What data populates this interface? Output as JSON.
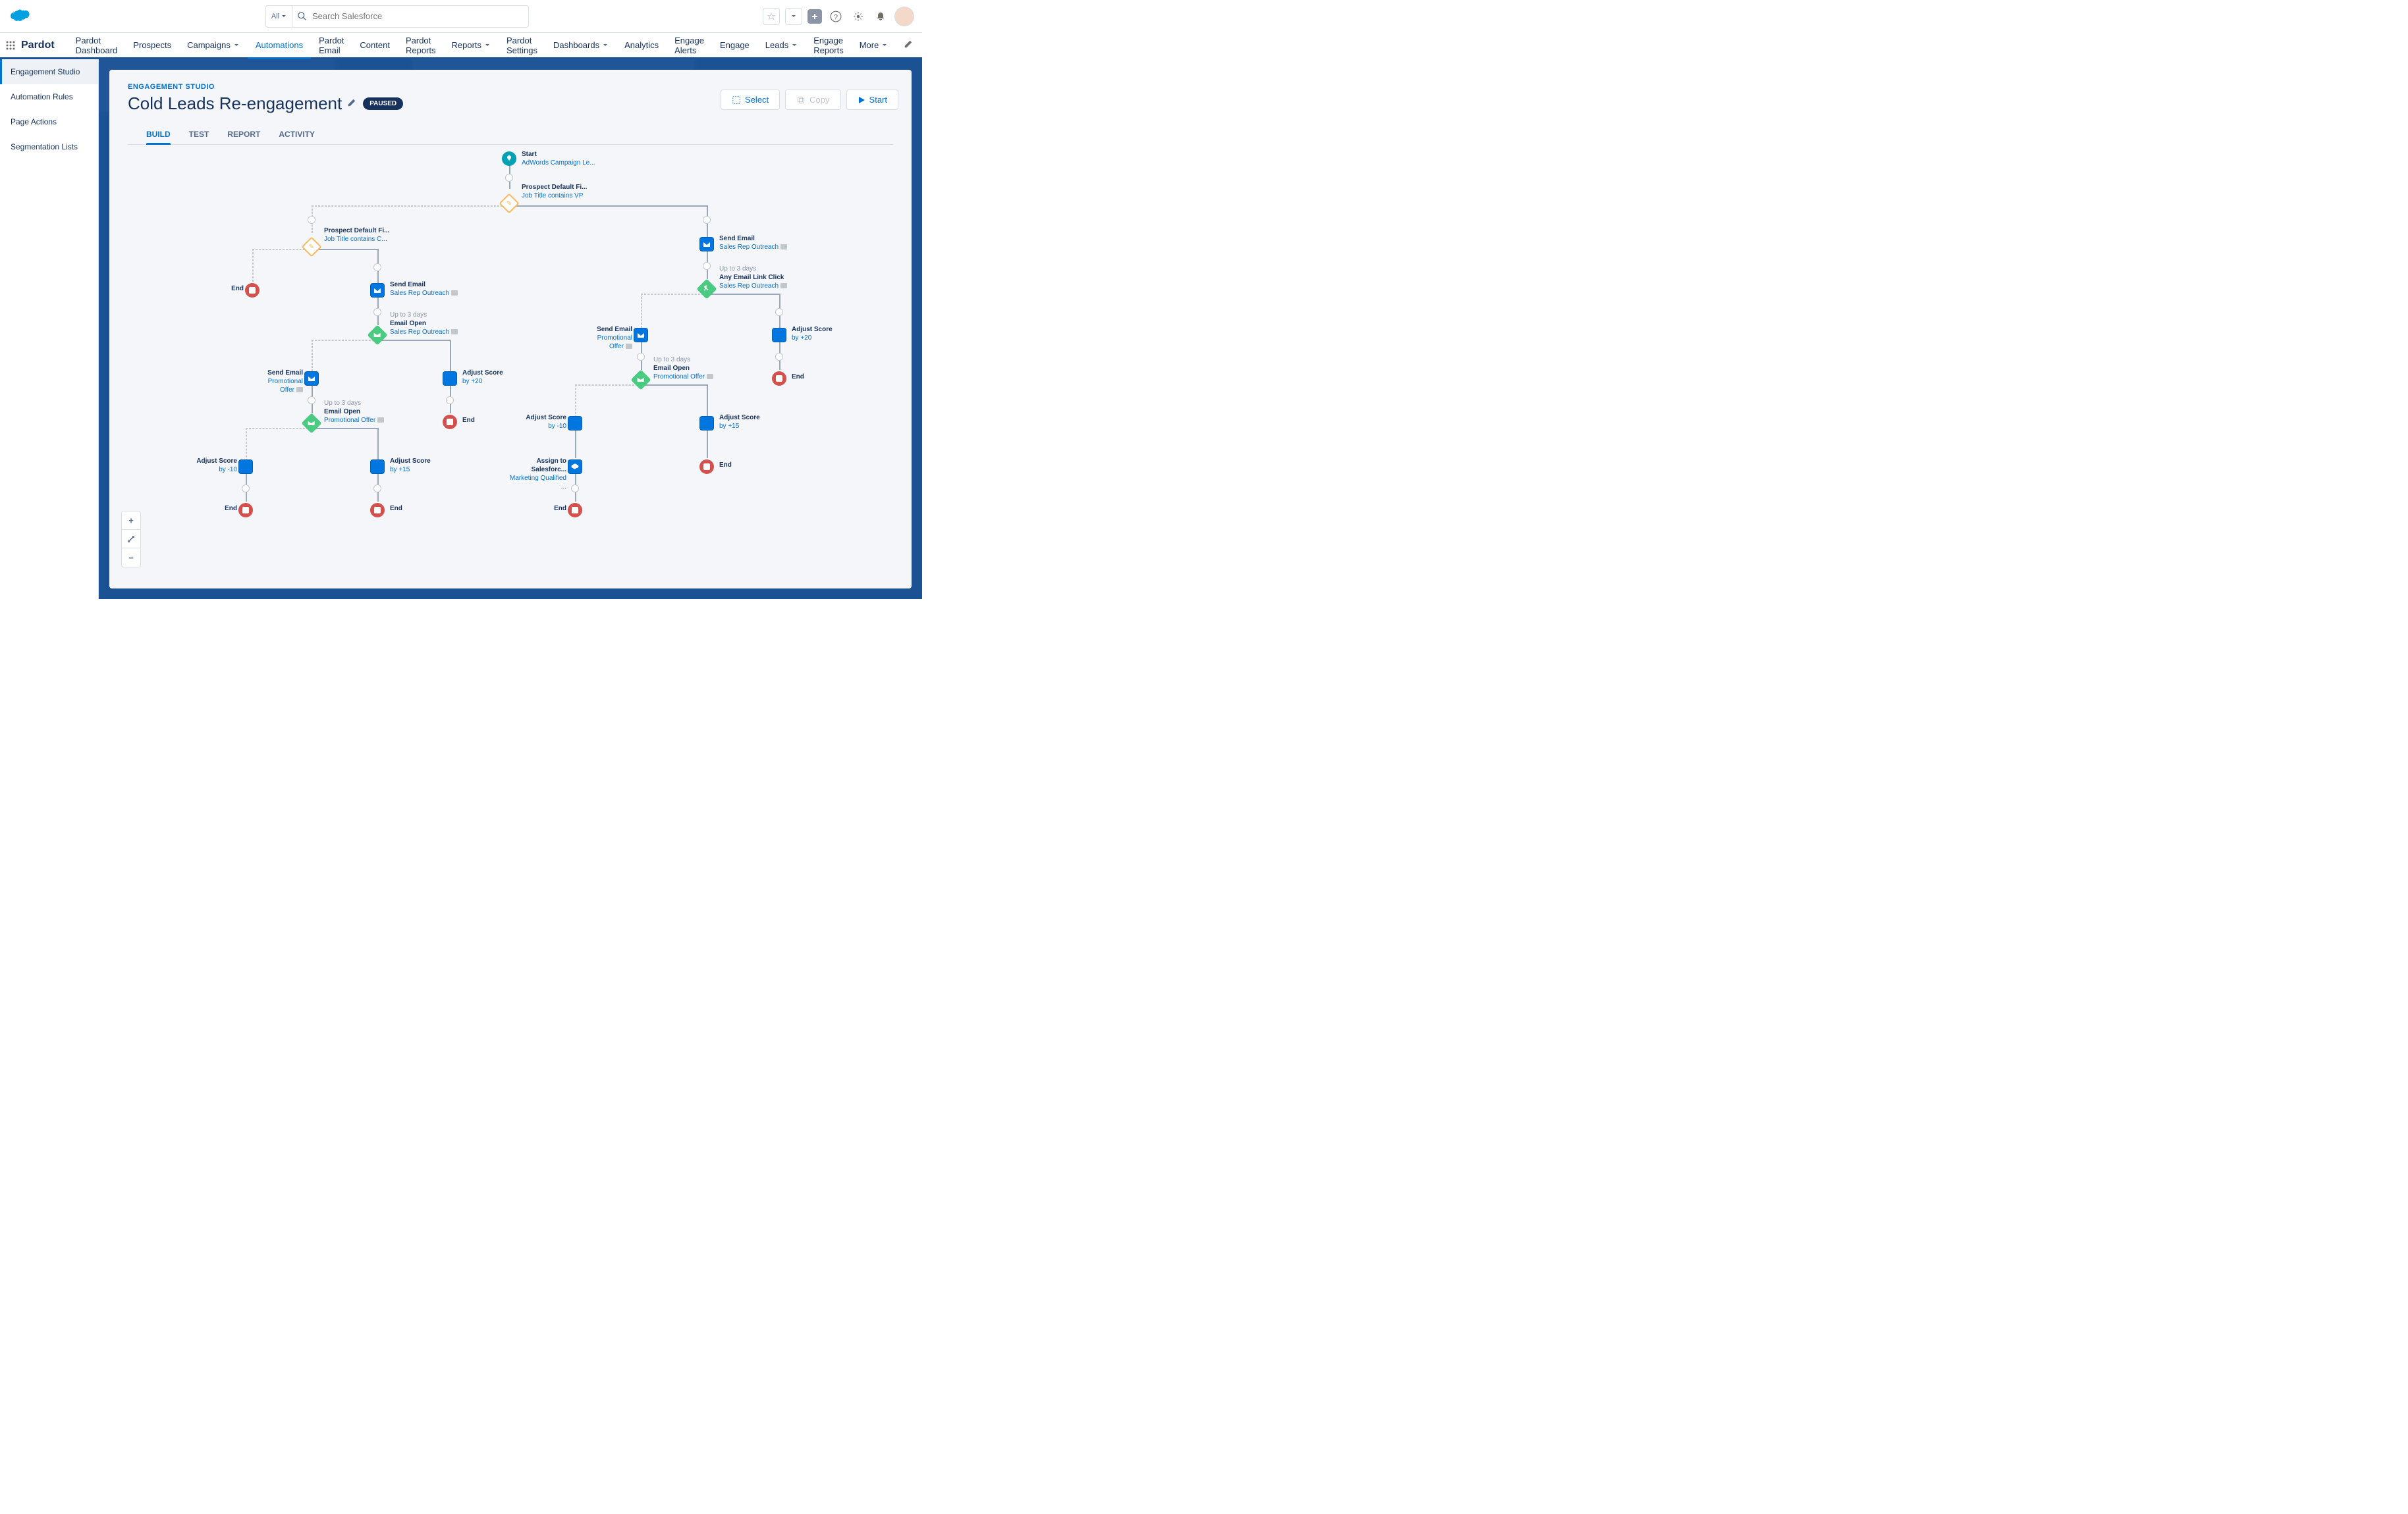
{
  "search": {
    "filter": "All",
    "placeholder": "Search Salesforce"
  },
  "brand": "Pardot",
  "nav": [
    "Pardot Dashboard",
    "Prospects",
    "Campaigns",
    "Automations",
    "Pardot Email",
    "Content",
    "Pardot Reports",
    "Reports",
    "Pardot Settings",
    "Dashboards",
    "Analytics",
    "Engage Alerts",
    "Engage",
    "Leads",
    "Engage Reports",
    "More"
  ],
  "nav_dropdown": [
    false,
    false,
    true,
    false,
    false,
    false,
    false,
    true,
    false,
    true,
    false,
    false,
    false,
    true,
    false,
    true
  ],
  "nav_active": 3,
  "sidebar": [
    "Engagement Studio",
    "Automation Rules",
    "Page Actions",
    "Segmentation Lists"
  ],
  "sidebar_active": 0,
  "crumb": "ENGAGEMENT STUDIO",
  "title": "Cold Leads Re-engagement",
  "status": "PAUSED",
  "actions": {
    "select": "Select",
    "copy": "Copy",
    "start": "Start"
  },
  "page_tabs": [
    "BUILD",
    "TEST",
    "REPORT",
    "ACTIVITY"
  ],
  "page_tab_active": 0,
  "flow": {
    "start": {
      "title": "Start",
      "sub": "AdWords Campaign Le..."
    },
    "rule1": {
      "title": "Prospect Default Fi...",
      "sub": "Job Title contains VP"
    },
    "rule2": {
      "title": "Prospect Default Fi...",
      "sub": "Job Title contains C..."
    },
    "send_email": "Send Email",
    "sales_rep": "Sales Rep Outreach",
    "promo": "Promotional Offer",
    "wait": "Up to 3 days",
    "email_open": "Email Open",
    "link_click": "Any Email Link Click",
    "adjust_score": "Adjust Score",
    "by_p20": "by +20",
    "by_p15": "by +15",
    "by_m10": "by -10",
    "assign": {
      "title": "Assign to Salesforc...",
      "sub": "Marketing Qualified ..."
    },
    "end": "End"
  }
}
